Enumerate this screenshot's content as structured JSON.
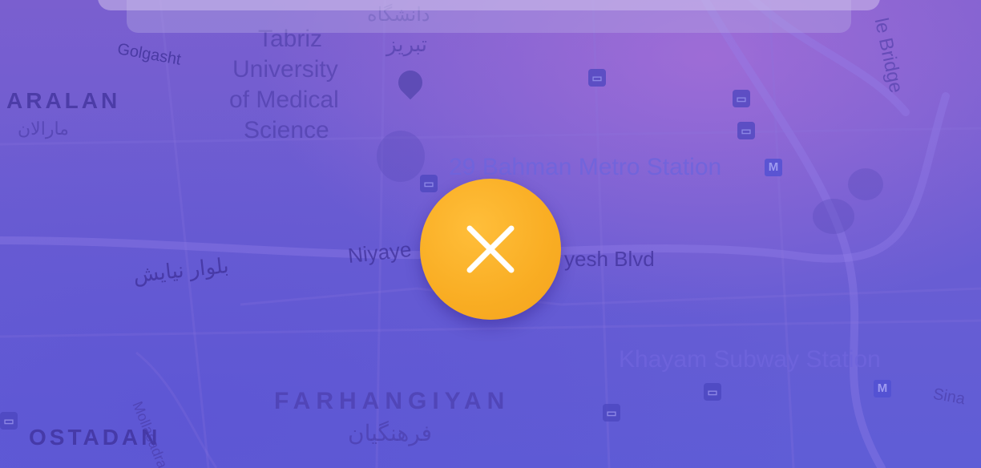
{
  "map": {
    "labels": {
      "golgasht": "Golgasht",
      "tabriz_univ": [
        "Tabriz",
        "University",
        "of Medical",
        "Science"
      ],
      "tabriz_fa": "تبریز",
      "univ_fa": "دانشگاه",
      "maralan": "ARALAN",
      "maralan_fa": "مارالان",
      "bahman_station": "29 Bahman Metro Station",
      "niyayesh_left": "Niyaye",
      "niyayesh_right": "yesh Blvd",
      "niyayesh_fa": "بلوار نیایش",
      "khayam_station": "Khayam Subway Station",
      "farhangiyan": "FARHANGIYAN",
      "farhangiyan_fa": "فرهنگیان",
      "ostadan": "OSTADAN",
      "mollasadra": "Mollasadra",
      "bridge": "le Bridge",
      "sina": "Sina"
    },
    "icons": {
      "bus": "bus-stop-icon",
      "metro": "metro-icon",
      "metro_glyph": "M",
      "pin": "university-pin-icon"
    }
  },
  "close_button": {
    "icon": "close-icon",
    "color": "#f9ad23",
    "glyph_color": "#ffffff"
  }
}
